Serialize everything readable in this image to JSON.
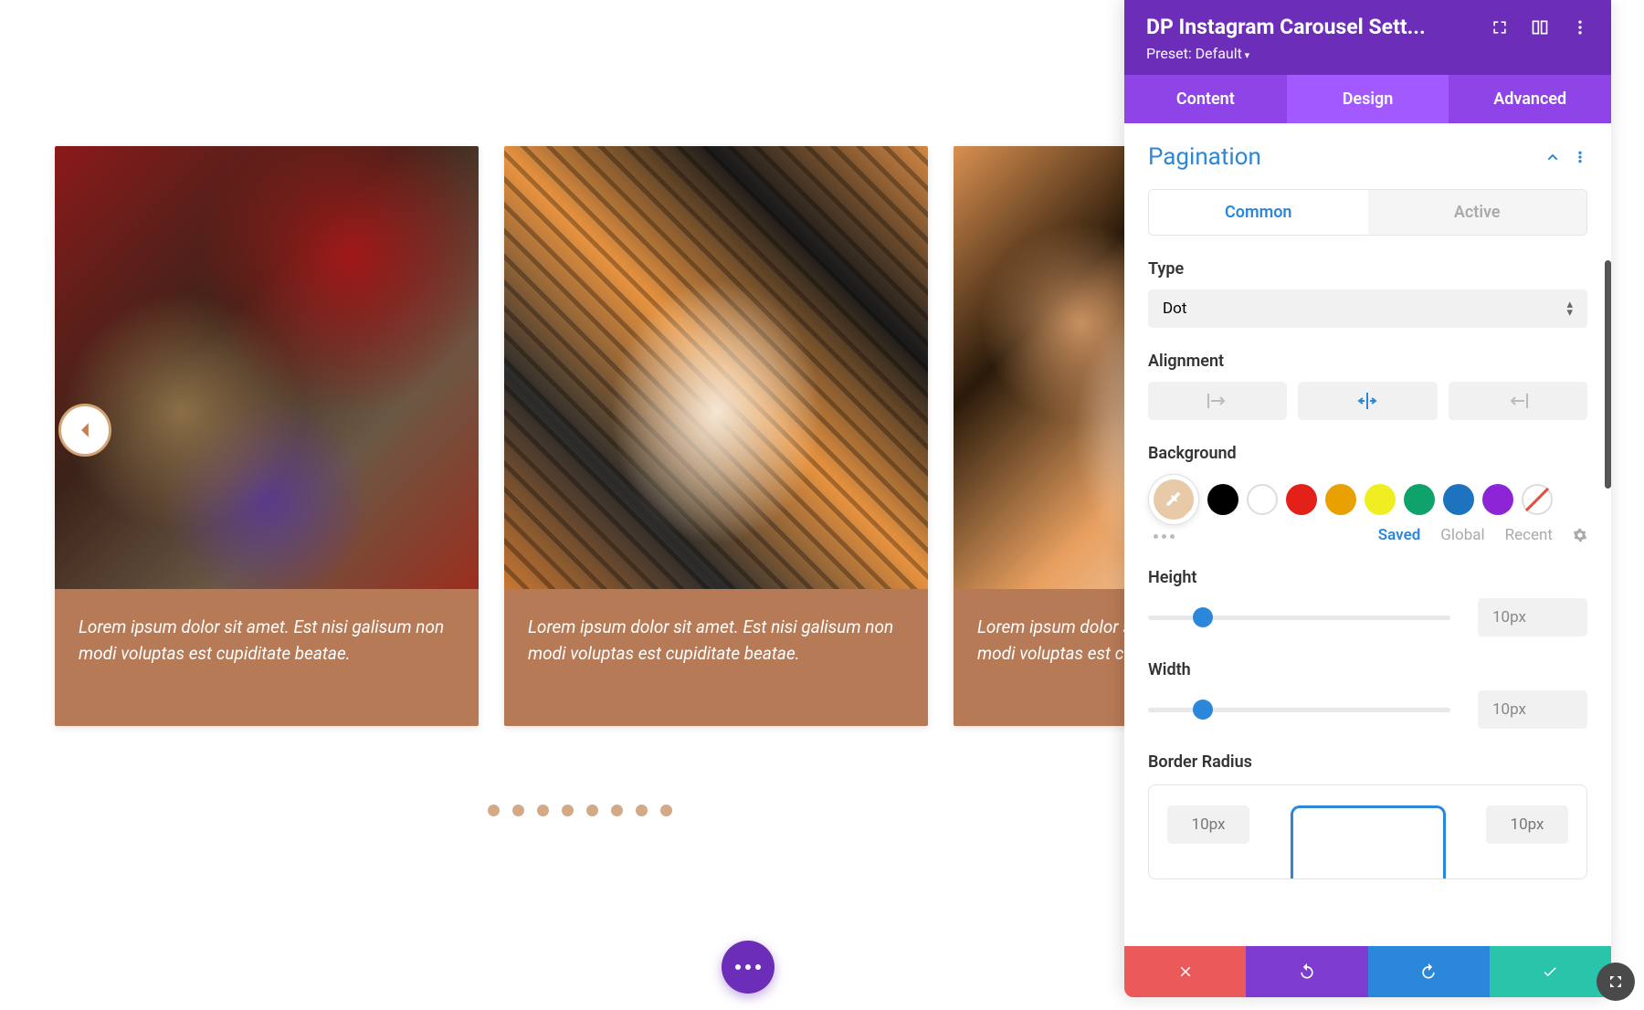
{
  "carousel": {
    "cards": [
      {
        "caption": "Lorem ipsum dolor sit amet. Est nisi galisum non modi voluptas est cupiditate beatae."
      },
      {
        "caption": "Lorem ipsum dolor sit amet. Est nisi galisum non modi voluptas est cupiditate beatae."
      },
      {
        "caption": "Lorem ipsum dolor sit amet. Est nisi galisum non modi voluptas est cupiditate beatae."
      }
    ],
    "dot_count": 8
  },
  "panel": {
    "title": "DP Instagram Carousel Sett...",
    "preset": "Preset: Default",
    "tabs": {
      "content": "Content",
      "design": "Design",
      "advanced": "Advanced"
    },
    "section": {
      "title": "Pagination",
      "subtabs": {
        "common": "Common",
        "active": "Active"
      },
      "type": {
        "label": "Type",
        "value": "Dot"
      },
      "alignment": {
        "label": "Alignment"
      },
      "background": {
        "label": "Background",
        "swatches": [
          "#000000",
          "#ffffff",
          "#e32119",
          "#e8a100",
          "#eeee22",
          "#0fa36b",
          "#1e73be",
          "#8d24d6"
        ],
        "palette_links": {
          "saved": "Saved",
          "global": "Global",
          "recent": "Recent"
        }
      },
      "height": {
        "label": "Height",
        "value": "10px"
      },
      "width": {
        "label": "Width",
        "value": "10px"
      },
      "border_radius": {
        "label": "Border Radius",
        "tl": "10px",
        "tr": "10px"
      }
    },
    "colors": {
      "header": "#6c2eb9",
      "tab_active": "#a259ff",
      "accent": "#2b87da",
      "caption_bg": "#b77a56"
    }
  }
}
